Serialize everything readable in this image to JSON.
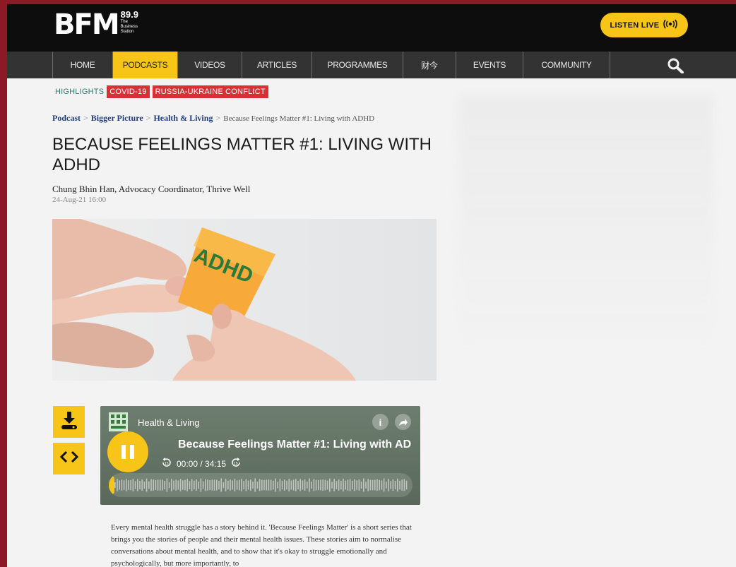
{
  "header": {
    "logo_text": "BFM",
    "logo_frequency": "89.9",
    "logo_tagline": "The\nBusiness\nStation",
    "listen_live_label": "LISTEN LIVE",
    "listen_live_icon": "broadcast-icon"
  },
  "nav": {
    "items": [
      {
        "label": "HOME",
        "active": false
      },
      {
        "label": "PODCASTS",
        "active": true
      },
      {
        "label": "VIDEOS",
        "active": false
      },
      {
        "label": "ARTICLES",
        "active": false
      },
      {
        "label": "PROGRAMMES",
        "active": false
      },
      {
        "label": "财今",
        "active": false
      },
      {
        "label": "EVENTS",
        "active": false
      },
      {
        "label": "COMMUNITY",
        "active": false
      }
    ],
    "search_icon": "search-icon"
  },
  "highlights": {
    "label": "HIGHLIGHTS",
    "tags": [
      "COVID-19",
      "RUSSIA-UKRAINE CONFLICT"
    ]
  },
  "breadcrumb": {
    "items": [
      "Podcast",
      "Bigger Picture",
      "Health & Living"
    ],
    "separator": ">",
    "current": "Because Feelings Matter #1: Living with ADHD"
  },
  "article": {
    "title": "BECAUSE FEELINGS MATTER #1: LIVING WITH ADHD",
    "author": "Chung Bhin Han, Advocacy Coordinator, Thrive Well",
    "date": "24-Aug-21 16:00",
    "image_note_text": "ADHD",
    "description": "Every mental health struggle has a story behind it. 'Because Feelings Matter' is a short series that brings you the stories of people and their mental health issues. These stories aim to normalise conversations about mental health, and to show that it's okay to struggle emotionally and psychologically, but more importantly, to"
  },
  "actions": {
    "download_icon": "download-icon",
    "embed_icon": "embed-code-icon"
  },
  "player": {
    "show_name": "Health & Living",
    "episode_title": "Because Feelings Matter #1: Living with ADHD",
    "time_current": "00:00",
    "time_total": "34:15",
    "time_separator": " / ",
    "rewind_label": "15",
    "forward_label": "15",
    "progress_fraction": 0.0,
    "info_icon": "info-icon",
    "share_icon": "share-icon"
  },
  "colors": {
    "accent": "#f7c418",
    "nav_bg": "#333333",
    "tag_red": "#d93036",
    "highlight_teal": "#2c7a73",
    "link_blue": "#1f3d7a"
  }
}
